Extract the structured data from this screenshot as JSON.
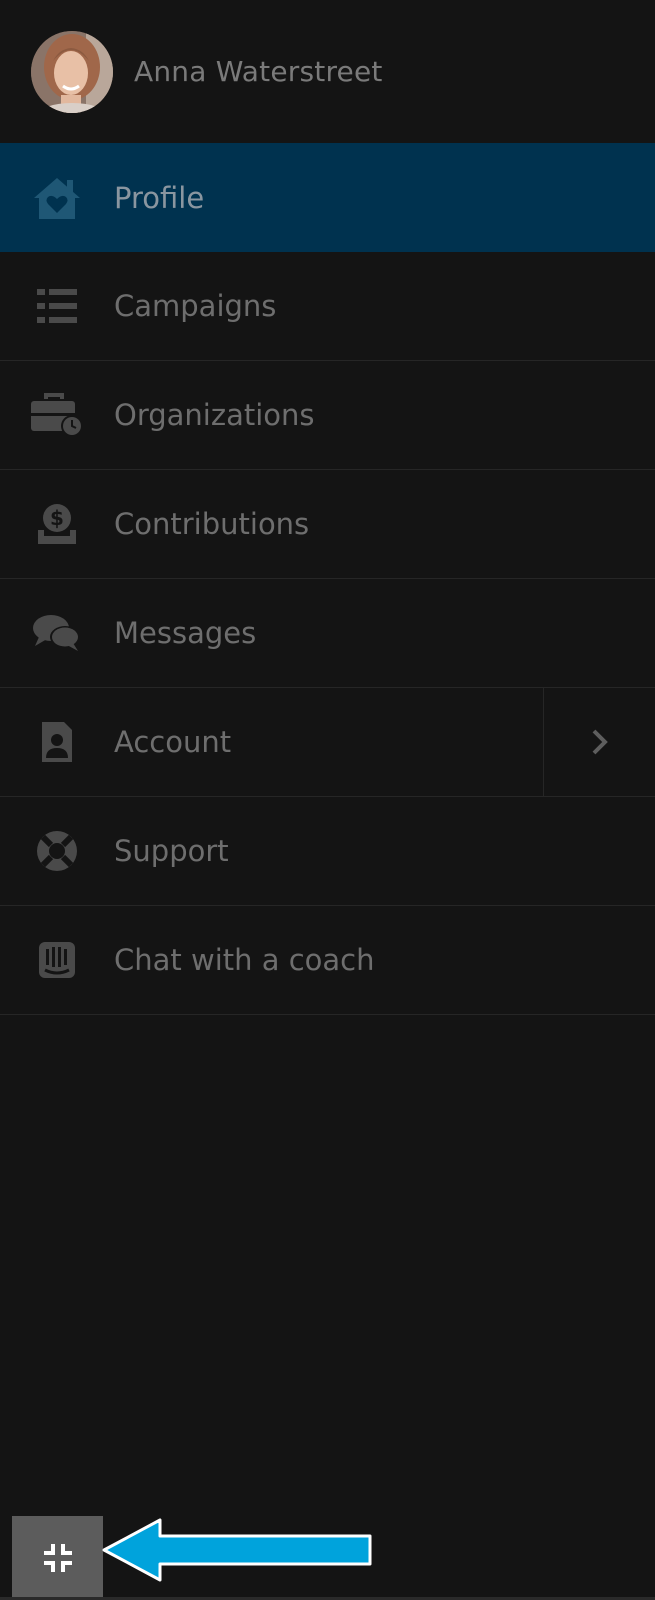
{
  "user": {
    "name": "Anna Waterstreet",
    "avatar_icon": "user-avatar-photo"
  },
  "menu": {
    "items": [
      {
        "label": "Profile",
        "icon": "home-heart-icon",
        "active": true
      },
      {
        "label": "Campaigns",
        "icon": "list-icon"
      },
      {
        "label": "Organizations",
        "icon": "briefcase-clock-icon"
      },
      {
        "label": "Contributions",
        "icon": "dollar-inbox-icon"
      },
      {
        "label": "Messages",
        "icon": "chat-bubbles-icon"
      },
      {
        "label": "Account",
        "icon": "contact-card-icon",
        "has_submenu": true
      },
      {
        "label": "Support",
        "icon": "lifebuoy-icon"
      },
      {
        "label": "Chat with a coach",
        "icon": "intercom-chat-icon"
      }
    ]
  },
  "footer": {
    "collapse_icon": "compress-icon",
    "annotation_icon": "pointer-arrow-icon"
  },
  "colors": {
    "background": "#141414",
    "active_item": "#00324f",
    "text": "#6e6e6e",
    "icon": "#4a4a4a",
    "active_icon": "#1f5775",
    "annotation_arrow": "#00a3dc"
  }
}
